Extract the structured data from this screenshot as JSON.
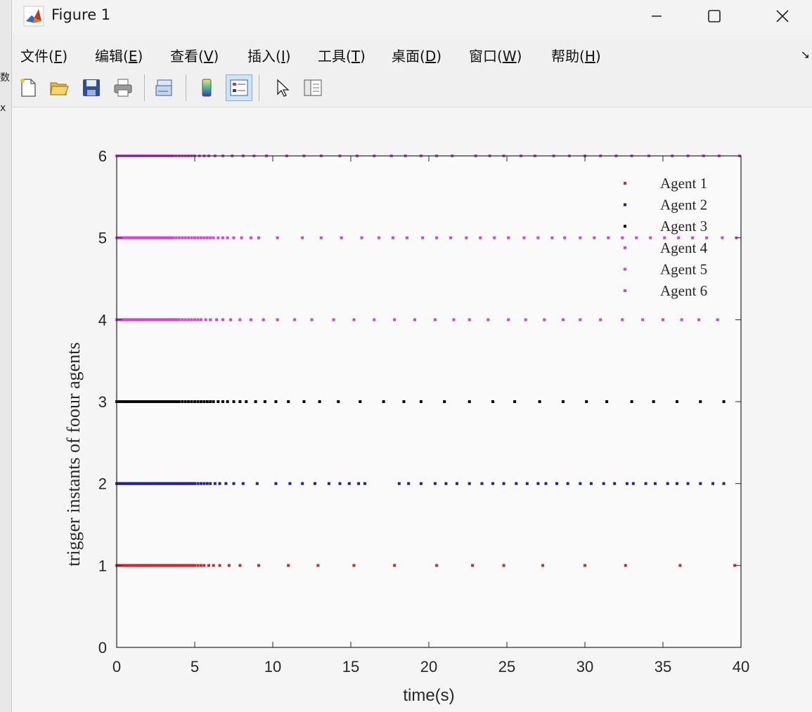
{
  "window": {
    "title": "Figure 1"
  },
  "background_fragments": [
    "数",
    "x"
  ],
  "menu": [
    {
      "label": "文件(",
      "key": "F",
      "end": ")"
    },
    {
      "label": "编辑(",
      "key": "E",
      "end": ")"
    },
    {
      "label": "查看(",
      "key": "V",
      "end": ")"
    },
    {
      "label": "插入(",
      "key": "I",
      "end": ")"
    },
    {
      "label": "工具(",
      "key": "T",
      "end": ")"
    },
    {
      "label": "桌面(",
      "key": "D",
      "end": ")"
    },
    {
      "label": "窗口(",
      "key": "W",
      "end": ")"
    },
    {
      "label": "帮助(",
      "key": "H",
      "end": ")"
    }
  ],
  "toolbar": [
    "new-figure-icon",
    "open-file-icon",
    "save-icon",
    "print-icon",
    "link-plot-icon",
    "colorbar-icon",
    "legend-icon",
    "pointer-icon",
    "property-inspector-icon"
  ],
  "colors": {
    "agent1": "#d62728",
    "agent2": "#1f1fa0",
    "agent3": "#000000",
    "agent456": "#e03ce0"
  },
  "chart_data": {
    "type": "scatter",
    "xlabel": "time(s)",
    "ylabel": "trigger instants of foour agents",
    "xlim": [
      0,
      40
    ],
    "ylim": [
      0,
      6
    ],
    "xticks": [
      "0",
      "5",
      "10",
      "15",
      "20",
      "25",
      "30",
      "35",
      "40"
    ],
    "yticks": [
      "0",
      "1",
      "2",
      "3",
      "4",
      "5",
      "6"
    ],
    "grid": false,
    "legend_position": "top-right",
    "series": [
      {
        "name": "Agent 1",
        "y": 1,
        "color": "#d62728",
        "x": [
          0,
          0.1,
          0.2,
          0.3,
          0.4,
          0.5,
          0.6,
          0.7,
          0.8,
          0.9,
          1.0,
          1.1,
          1.2,
          1.3,
          1.4,
          1.5,
          1.6,
          1.7,
          1.8,
          1.9,
          2.0,
          2.1,
          2.2,
          2.3,
          2.4,
          2.5,
          2.6,
          2.7,
          2.8,
          2.9,
          3.0,
          3.1,
          3.2,
          3.3,
          3.4,
          3.5,
          3.6,
          3.7,
          3.8,
          3.9,
          4.0,
          4.1,
          4.2,
          4.3,
          4.4,
          4.5,
          4.6,
          4.7,
          4.8,
          4.9,
          5.0,
          5.2,
          5.4,
          5.6,
          5.9,
          6.2,
          6.6,
          7.2,
          7.9,
          9.1,
          11.0,
          12.9,
          15.2,
          17.8,
          20.5,
          22.8,
          24.8,
          27.3,
          30.0,
          32.6,
          36.1,
          39.6
        ]
      },
      {
        "name": "Agent 2",
        "y": 2,
        "color": "#1f1fa0",
        "x": [
          0,
          0.1,
          0.2,
          0.3,
          0.4,
          0.5,
          0.6,
          0.7,
          0.8,
          0.9,
          1.0,
          1.1,
          1.2,
          1.3,
          1.4,
          1.5,
          1.6,
          1.7,
          1.8,
          1.9,
          2.0,
          2.1,
          2.2,
          2.3,
          2.4,
          2.5,
          2.6,
          2.7,
          2.8,
          2.9,
          3.0,
          3.1,
          3.2,
          3.3,
          3.4,
          3.5,
          3.6,
          3.7,
          3.8,
          3.9,
          4.0,
          4.1,
          4.2,
          4.3,
          4.4,
          4.5,
          4.6,
          4.7,
          4.8,
          4.9,
          5.0,
          5.2,
          5.4,
          5.6,
          5.8,
          6.0,
          6.3,
          6.6,
          7.0,
          7.5,
          8.1,
          9.0,
          10.2,
          11.1,
          11.9,
          12.7,
          13.6,
          14.3,
          14.9,
          15.5,
          15.9,
          18.1,
          18.7,
          19.5,
          20.4,
          21.1,
          21.8,
          22.6,
          23.4,
          24.1,
          24.8,
          25.6,
          26.3,
          27.0,
          27.5,
          28.2,
          28.9,
          29.7,
          30.4,
          31.2,
          31.9,
          32.7,
          33.1,
          33.9,
          34.5,
          35.3,
          35.9,
          36.6,
          37.4,
          38.2,
          38.9
        ]
      },
      {
        "name": "Agent 3",
        "y": 3,
        "color": "#000000",
        "x": [
          0,
          0.1,
          0.2,
          0.3,
          0.4,
          0.5,
          0.6,
          0.7,
          0.8,
          0.9,
          1.0,
          1.1,
          1.2,
          1.3,
          1.4,
          1.5,
          1.6,
          1.7,
          1.8,
          1.9,
          2.0,
          2.1,
          2.2,
          2.3,
          2.4,
          2.5,
          2.6,
          2.7,
          2.8,
          2.9,
          3.0,
          3.1,
          3.2,
          3.3,
          3.4,
          3.5,
          3.6,
          3.7,
          3.8,
          3.9,
          4.0,
          4.2,
          4.4,
          4.6,
          4.8,
          5.0,
          5.2,
          5.4,
          5.6,
          5.8,
          6.0,
          6.2,
          6.5,
          6.8,
          7.1,
          7.5,
          7.9,
          8.3,
          8.9,
          9.5,
          10.2,
          11.0,
          12.0,
          13.0,
          14.2,
          15.6,
          17.1,
          18.4,
          19.5,
          21.0,
          22.6,
          24.1,
          25.5,
          27.1,
          28.6,
          30.1,
          31.4,
          33.0,
          34.4,
          35.9,
          37.4,
          38.9
        ]
      },
      {
        "name": "Agent 4",
        "y": 4,
        "color": "#e03ce0",
        "x": [
          0,
          0.1,
          0.2,
          0.3,
          0.4,
          0.5,
          0.6,
          0.7,
          0.8,
          0.9,
          1.0,
          1.1,
          1.2,
          1.3,
          1.4,
          1.5,
          1.6,
          1.7,
          1.8,
          1.9,
          2.0,
          2.1,
          2.2,
          2.3,
          2.4,
          2.5,
          2.6,
          2.7,
          2.8,
          2.9,
          3.0,
          3.1,
          3.2,
          3.3,
          3.4,
          3.5,
          3.6,
          3.7,
          3.8,
          3.9,
          4.0,
          4.2,
          4.4,
          4.6,
          4.8,
          5.0,
          5.2,
          5.4,
          5.7,
          6.0,
          6.4,
          6.8,
          7.3,
          7.9,
          8.6,
          9.4,
          10.3,
          11.4,
          12.5,
          13.9,
          15.2,
          16.5,
          17.8,
          19.1,
          20.4,
          21.6,
          22.6,
          23.8,
          25.1,
          26.2,
          27.4,
          28.6,
          29.7,
          31.0,
          32.4,
          33.7,
          35.0,
          36.2,
          37.3,
          38.5
        ]
      },
      {
        "name": "Agent 5",
        "y": 5,
        "color": "#e03ce0",
        "x": [
          0,
          0.1,
          0.2,
          0.3,
          0.4,
          0.5,
          0.6,
          0.7,
          0.8,
          0.9,
          1.0,
          1.1,
          1.2,
          1.3,
          1.4,
          1.5,
          1.6,
          1.7,
          1.8,
          1.9,
          2.0,
          2.1,
          2.2,
          2.3,
          2.4,
          2.5,
          2.6,
          2.7,
          2.8,
          2.9,
          3.0,
          3.1,
          3.2,
          3.3,
          3.4,
          3.5,
          3.6,
          3.8,
          4.0,
          4.2,
          4.4,
          4.6,
          4.8,
          5.0,
          5.2,
          5.4,
          5.6,
          5.8,
          6.0,
          6.2,
          6.5,
          6.8,
          7.1,
          7.5,
          8.0,
          8.6,
          9.1,
          10.3,
          11.9,
          13.1,
          14.4,
          15.7,
          16.8,
          17.7,
          18.6,
          19.6,
          20.5,
          21.4,
          22.4,
          23.3,
          24.2,
          25.1,
          26.1,
          27.0,
          27.9,
          28.7,
          29.7,
          30.6,
          31.5,
          32.4,
          33.3,
          34.2,
          35.1,
          36.0,
          36.9,
          37.8,
          38.8,
          39.7
        ]
      },
      {
        "name": "Agent 6",
        "y": 6,
        "color": "#e03ce0",
        "x": [
          0,
          0.1,
          0.2,
          0.3,
          0.4,
          0.5,
          0.6,
          0.7,
          0.8,
          0.9,
          1.0,
          1.1,
          1.2,
          1.3,
          1.4,
          1.5,
          1.6,
          1.7,
          1.8,
          1.9,
          2.0,
          2.1,
          2.2,
          2.3,
          2.4,
          2.5,
          2.6,
          2.7,
          2.8,
          2.9,
          3.0,
          3.1,
          3.2,
          3.3,
          3.4,
          3.5,
          3.6,
          3.8,
          4.0,
          4.2,
          4.4,
          4.6,
          4.8,
          5.0,
          5.3,
          5.6,
          5.9,
          6.3,
          6.8,
          7.4,
          8.1,
          8.8,
          9.6,
          10.9,
          12.0,
          13.1,
          14.3,
          15.4,
          16.5,
          17.6,
          18.5,
          19.5,
          20.5,
          21.5,
          23.0,
          23.9,
          24.8,
          25.9,
          26.8,
          28.0,
          29.0,
          30.0,
          31.0,
          32.0,
          33.0,
          34.1,
          35.6,
          36.6,
          37.6,
          38.6,
          39.9
        ]
      }
    ]
  }
}
